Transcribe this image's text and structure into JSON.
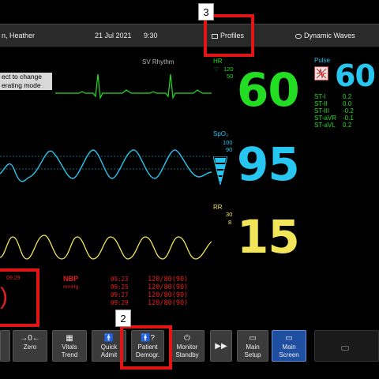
{
  "topbar": {
    "patient_name": "n, Heather",
    "date": "21 Jul 2021",
    "time": "9:30",
    "profiles_label": "Profiles",
    "waves_label": "Dynamic Waves"
  },
  "message": {
    "line1": "ect to change",
    "line2": "erating mode"
  },
  "ecg": {
    "rhythm": "SV Rhythm",
    "hr_label": "HR",
    "hr_high": "120",
    "hr_low": "50",
    "hr_value": "60",
    "color": "#22dd22"
  },
  "pulse": {
    "label": "Pulse",
    "value": "60",
    "color": "#27c6f0"
  },
  "st": {
    "labels": [
      "ST-I",
      "ST-II",
      "ST-III",
      "ST-aVR",
      "ST-aVL"
    ],
    "values": [
      "0.2",
      "0.0",
      "-0.2",
      "-0.1",
      "0.2"
    ],
    "color": "#22dd22"
  },
  "spo2": {
    "label": "SpO₂",
    "high": "100",
    "low": "90",
    "value": "95",
    "color": "#27c6f0"
  },
  "resp": {
    "label": "RR",
    "high": "30",
    "low": "8",
    "value": "15",
    "color": "#f2e55a"
  },
  "nbp": {
    "label": "NBP",
    "unit": "mmHg",
    "current_time": "09:29",
    "current_value": ")",
    "times": [
      "09:23",
      "09:25",
      "09:27",
      "09:29"
    ],
    "values": [
      "120/80(90)",
      "120/80(90)",
      "120/80(90)",
      "120/80(90)"
    ],
    "color": "#e02020"
  },
  "softkeys": [
    {
      "label1": "",
      "label2": "",
      "icon": ""
    },
    {
      "label1": "Zero",
      "label2": "",
      "icon": "→0←"
    },
    {
      "label1": "Vitals",
      "label2": "Trend",
      "icon": "▦"
    },
    {
      "label1": "Quick",
      "label2": "Admit",
      "icon": "🚹"
    },
    {
      "label1": "Patient",
      "label2": "Demogr.",
      "icon": "🚹?"
    },
    {
      "label1": "Monitor",
      "label2": "Standby",
      "icon": "⏻"
    },
    {
      "label1": "",
      "label2": "",
      "icon": "▶▶"
    },
    {
      "label1": "Main",
      "label2": "Setup",
      "icon": "▭"
    },
    {
      "label1": "Main",
      "label2": "Screen",
      "icon": "▭"
    }
  ],
  "callouts": {
    "profiles": "3",
    "patient_demogr": "2"
  }
}
